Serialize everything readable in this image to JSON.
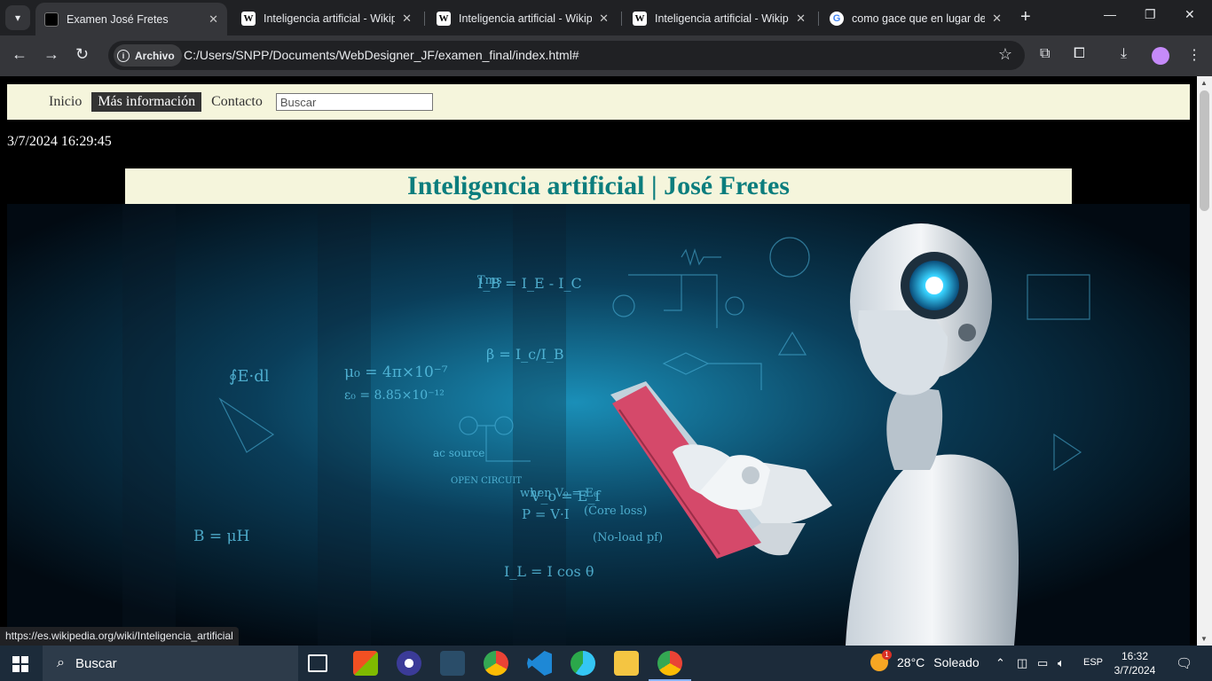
{
  "browser": {
    "tabs": [
      {
        "title": "Examen José Fretes",
        "favicon": "dark-page-icon",
        "active": true
      },
      {
        "title": "Inteligencia artificial - Wikipe",
        "favicon": "wikipedia-icon"
      },
      {
        "title": "Inteligencia artificial - Wikipe",
        "favicon": "wikipedia-icon"
      },
      {
        "title": "Inteligencia artificial - Wikipe",
        "favicon": "wikipedia-icon"
      },
      {
        "title": "como gace que en lugar de",
        "favicon": "google-icon"
      }
    ],
    "security_chip": "Archivo",
    "address": "C:/Users/SNPP/Documents/WebDesigner_JF/examen_final/index.html#",
    "status_url": "https://es.wikipedia.org/wiki/Inteligencia_artificial"
  },
  "site": {
    "nav": [
      "Inicio",
      "Más información",
      "Contacto"
    ],
    "nav_current": "Más información",
    "search_placeholder": "Buscar",
    "datetime": "3/7/2024 16:29:45",
    "heading": "Inteligencia artificial | José Fretes",
    "heading_color": "#0b7d7d",
    "nav_bg": "#f5f5dc",
    "hero_formulas": [
      "μ₀ = 4π×10⁻⁷",
      "ε₀ = 8.85×10⁻¹²",
      "β = I_c/I_B",
      "I_B = I_E - I_C",
      "V_o = E_f",
      "I_L = I cos θ",
      "P = V·I",
      "∮E·dl",
      "B = μH",
      "OPEN CIRCUIT",
      "when V₀ = E₀",
      "(No-load pf)",
      "(Core loss)",
      "ac source",
      "Tms"
    ]
  },
  "taskbar": {
    "search": "Buscar",
    "temperature": "28°C",
    "weather": "Soleado",
    "weather_badge": "1",
    "language": "ESP",
    "time": "16:32",
    "date": "3/7/2024"
  }
}
